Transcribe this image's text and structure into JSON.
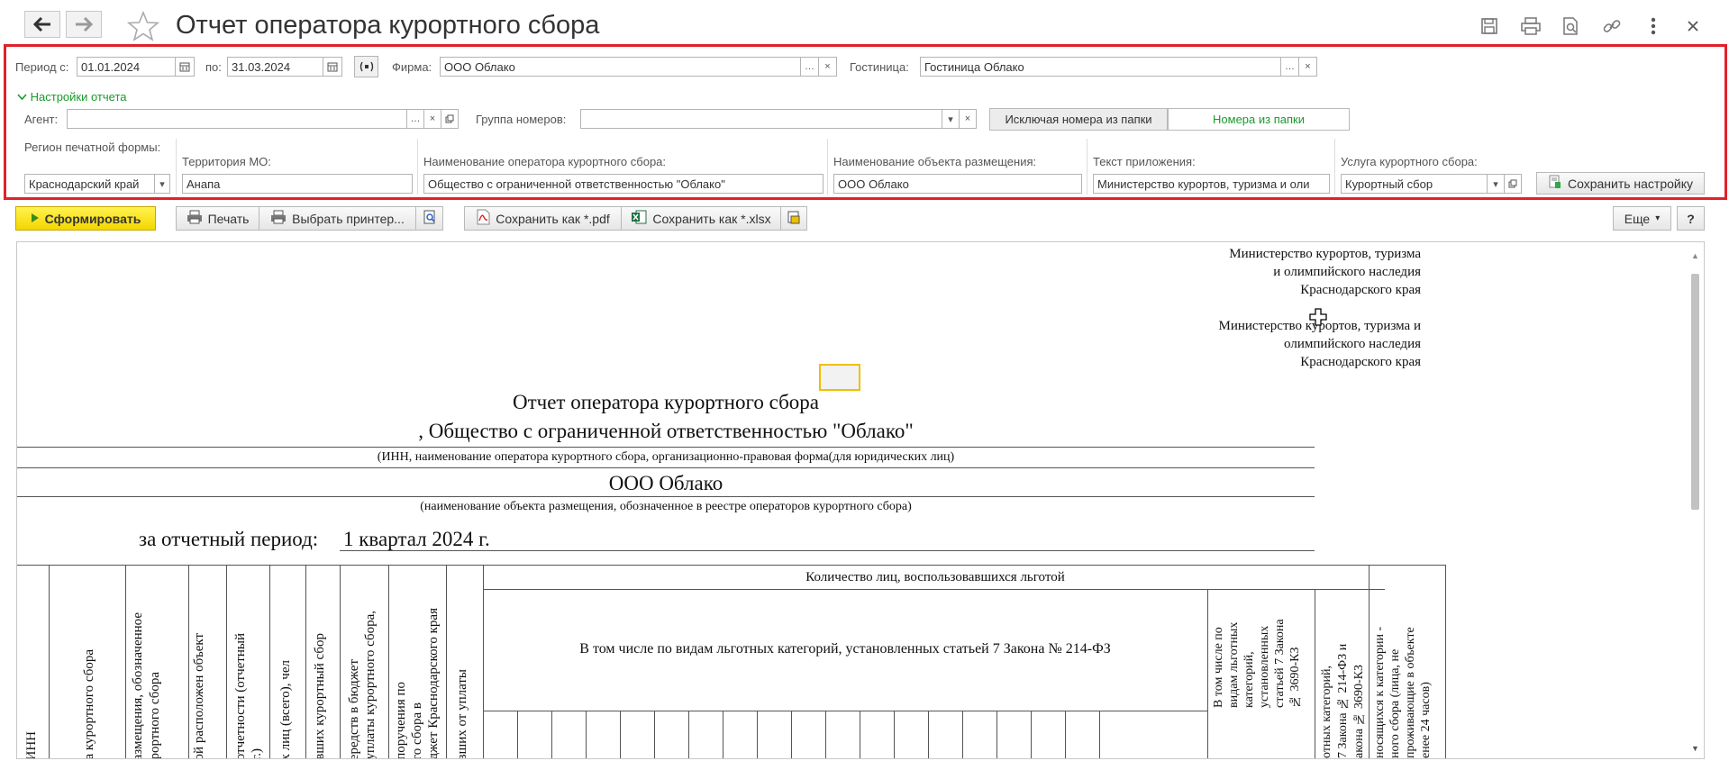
{
  "window": {
    "title": "Отчет оператора курортного сбора",
    "back_icon": "arrow-left-icon",
    "forward_icon": "arrow-right-icon",
    "favorite_icon": "star-icon"
  },
  "filters": {
    "period_from_label": "Период с:",
    "period_from": "01.01.2024",
    "period_to_label": "по:",
    "period_to": "31.03.2024",
    "firm_label": "Фирма:",
    "firm": "ООО Облако",
    "hotel_label": "Гостиница:",
    "hotel": "Гостиница Облако",
    "settings_toggle": "Настройки отчета",
    "agent_label": "Агент:",
    "agent": "",
    "room_group_label": "Группа номеров:",
    "room_group": "",
    "exclude_rooms_button": "Исключая номера из папки",
    "rooms_from_folder_button": "Номера из папки",
    "region_label": "Регион печатной формы:",
    "region": "Краснодарский край",
    "territory_label": "Территория МО:",
    "territory": "Анапа",
    "operator_name_label": "Наименование оператора курортного сбора:",
    "operator_name": "Общество с ограниченной ответственностью \"Облако\"",
    "object_name_label": "Наименование объекта размещения:",
    "object_name": "ООО Облако",
    "appendix_text_label": "Текст приложения:",
    "appendix_text": "Министерство курортов, туризма и оли",
    "service_label": "Услуга курортного сбора:",
    "service": "Курортный сбор",
    "save_settings_button": "Сохранить настройку"
  },
  "toolbar": {
    "generate": "Сформировать",
    "print": "Печать",
    "choose_printer": "Выбрать принтер...",
    "save_pdf": "Сохранить как *.pdf",
    "save_xlsx": "Сохранить как *.xlsx",
    "more": "Еще",
    "help": "?"
  },
  "report": {
    "header_line1": "Министерство курортов, туризма",
    "header_line2": "и олимпийского наследия",
    "header_line3": "Краснодарского края",
    "header2_line1": "Министерство курортов, туризма и",
    "header2_line2": "олимпийского наследия",
    "header2_line3": "Краснодарского края",
    "title": "Отчет оператора курортного сбора",
    "operator_line": ", Общество с ограниченной ответственностью \"Облако\"",
    "operator_caption": "(ИНН, наименование оператора курортного сбора, организационно-правовая форма(для юридических лиц)",
    "object_name": "ООО Облако",
    "object_caption": "(наименование объекта размещения, обозначенное в реестре операторов курортного сбора)",
    "period_label": "за отчетный период:",
    "period_value": "1 квартал 2024 г.",
    "table": {
      "benefit_header": "Количество лиц, воспользовавшихся льготой",
      "category_header": "В том числе по видам льготных категорий, установленных статьей 7 Закона № 214-ФЗ",
      "columns": [
        "ИНН",
        "а курортного сбора",
        "азмещения, обозначенное",
        "рортного сбора",
        "ой расположен объект",
        "отчетности (отчетный",
        "г.)",
        "х лиц (всего), чел",
        "вших курортный сбор",
        "ередств в бюджет",
        "уплаты курортного сбора,",
        "поручения по",
        "го сбора в",
        "джет Краснодарского края",
        "вших от уплаты"
      ],
      "right_col1": [
        "В том числе по",
        "видам льготных",
        "категорий,",
        "установленных",
        "статьей 7 Закона",
        "№ 3690-КЗ"
      ],
      "right_col2": [
        "отных категорий,",
        "7 Закона № 214-ФЗ и",
        "акона № 3690-КЗ"
      ],
      "right_col3": [
        "носящихся к категории -",
        "ного сбора (лица, не",
        "проживающие в объекте",
        "енее 24 часов)"
      ]
    }
  }
}
